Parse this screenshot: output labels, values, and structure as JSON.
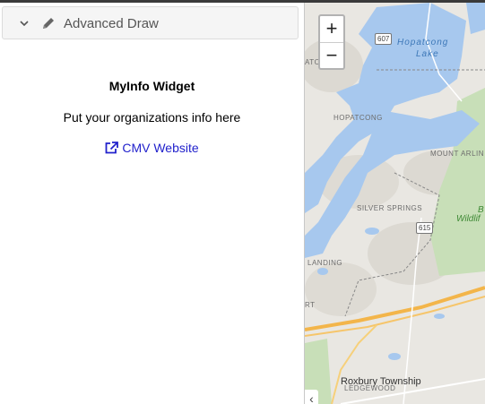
{
  "sidebar": {
    "panel": {
      "title": "Advanced Draw",
      "chevron_icon": "chevron-down-icon",
      "tool_icon": "pencil-icon"
    },
    "widget": {
      "title": "MyInfo Widget",
      "text": "Put your organizations info here",
      "link_label": "CMV Website",
      "link_icon": "external-link-icon",
      "link_color": "#2222cc"
    }
  },
  "map": {
    "zoom_in": "+",
    "zoom_out": "−",
    "collapse_label": "‹",
    "labels": {
      "hopatcong_lake_1": "Hopatcong",
      "hopatcong_lake_2": "Lake",
      "hopatcong": "HOPATCONG",
      "mount_arlington": "MOUNT ARLIN",
      "silver_springs": "SILVER SPRINGS",
      "landing": "LANDING",
      "atc_hills": "ATC HILLS",
      "route_607": "607",
      "route_615": "615",
      "park_1": "B",
      "park_2": "Wildlif",
      "roxbury": "Roxbury Township",
      "ledgewood": "LEDGEWOOD",
      "rt": "RT"
    },
    "colors": {
      "water": "#a7c8ee",
      "land": "#e9e7e2",
      "park": "#c8dfb8",
      "highway": "#f3b54a"
    }
  }
}
